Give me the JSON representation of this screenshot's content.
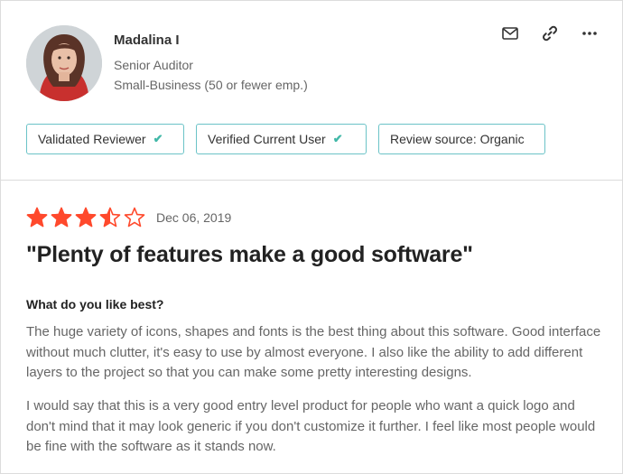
{
  "reviewer": {
    "name": "Madalina I",
    "role": "Senior Auditor",
    "company_size": "Small-Business (50 or fewer emp.)",
    "avatar_icon": "avatar-photo"
  },
  "actions": {
    "mail_icon": "mail-icon",
    "link_icon": "link-icon",
    "more_icon": "more-icon"
  },
  "badges": [
    {
      "label": "Validated Reviewer",
      "check": "✔"
    },
    {
      "label": "Verified Current User",
      "check": "✔"
    },
    {
      "label": "Review source: Organic"
    }
  ],
  "review": {
    "rating": 3.5,
    "rating_max": 5,
    "star_color": "#ff492c",
    "date": "Dec 06, 2019",
    "title": "\"Plenty of features make a good software\"",
    "question": "What do you like best?",
    "paragraphs": [
      "The huge variety of icons, shapes and fonts is the best thing about this software. Good interface without much clutter, it's easy to use by almost everyone. I also like the ability to add different layers to the project so that you can make some pretty interesting designs.",
      "I would say that this is a very good entry level product for people who want a quick logo and don't mind that it may look generic if you don't customize it further. I feel like most people would be fine with the software as it stands now."
    ]
  },
  "colors": {
    "badge_border": "#6bc3c7",
    "check": "#42b8a8",
    "text_muted": "#666666"
  }
}
